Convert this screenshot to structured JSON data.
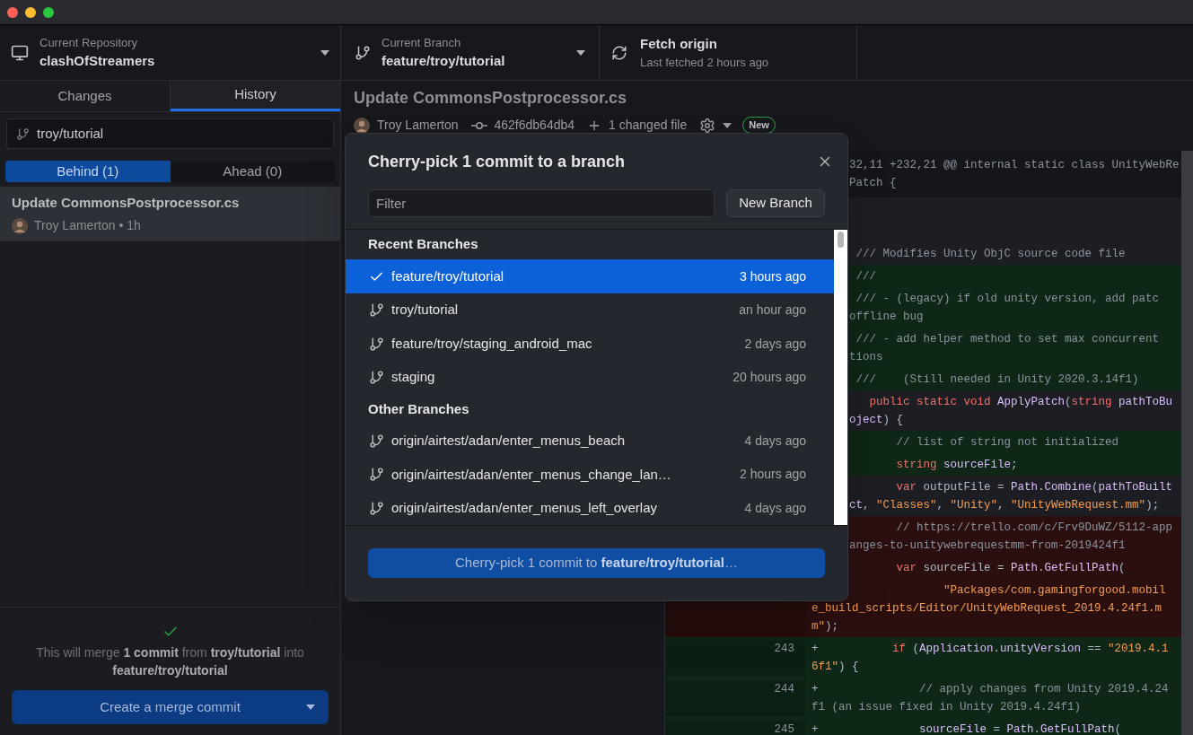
{
  "toolbar": {
    "repository": {
      "label": "Current Repository",
      "value": "clashOfStreamers"
    },
    "branch": {
      "label": "Current Branch",
      "value": "feature/troy/tutorial"
    },
    "fetch": {
      "label": "Fetch origin",
      "detail": "Last fetched 2 hours ago"
    }
  },
  "sidebar": {
    "tabs": [
      {
        "label": "Changes",
        "selected": false
      },
      {
        "label": "History",
        "selected": true
      }
    ],
    "branch_filter": {
      "value": "troy/tutorial"
    },
    "compare_tabs": [
      {
        "label": "Behind (1)",
        "selected": true
      },
      {
        "label": "Ahead (0)",
        "selected": false
      }
    ],
    "commits": [
      {
        "title": "Update CommonsPostprocessor.cs",
        "byline": "Troy Lamerton • 1h",
        "selected": true
      }
    ],
    "merge": {
      "message": "This will merge **1 commit** from **troy/tutorial** into **feature/troy/tutorial**",
      "button": "Create a merge commit"
    }
  },
  "commit": {
    "title": "Update CommonsPostprocessor.cs",
    "author": "Troy Lamerton",
    "sha": "462f6db64db4",
    "changed": "1 changed file",
    "badge": "New"
  },
  "diff": {
    "rows": [
      {
        "kind": "hunk",
        "lines": [
          {
            "code": [
              {
                "text": "32,11 +232,21 @@ internal static class UnityWebRe",
                "kind": "plain"
              }
            ]
          },
          {
            "code": [
              {
                "text": "Patch {",
                "kind": "plain"
              }
            ]
          }
        ]
      },
      {
        "kind": "context"
      },
      {
        "kind": "context"
      },
      {
        "kind": "context",
        "lines": [
          {
            "code": [
              {
                "text": " /// Modifies Unity ObjC source code file",
                "kind": "comment"
              }
            ]
          }
        ]
      },
      {
        "kind": "added",
        "lines": [
          {
            "code": [
              {
                "text": " ///",
                "kind": "comment"
              }
            ]
          }
        ]
      },
      {
        "kind": "added",
        "lines": [
          {
            "code": [
              {
                "text": " /// - (legacy) if old unity version, add patc",
                "kind": "comment"
              }
            ]
          },
          {
            "code": [
              {
                "text": "offline bug",
                "kind": "comment"
              }
            ]
          }
        ]
      },
      {
        "kind": "added",
        "lines": [
          {
            "code": [
              {
                "text": " /// - add helper method to set max concurrent",
                "kind": "comment"
              }
            ]
          },
          {
            "code": [
              {
                "text": "tions",
                "kind": "comment"
              }
            ]
          }
        ]
      },
      {
        "kind": "added",
        "lines": [
          {
            "code": [
              {
                "text": " ///    (Still needed in Unity 2020.3.14f1)",
                "kind": "comment"
              }
            ]
          }
        ]
      },
      {
        "kind": "context",
        "lines": [
          {
            "code": [
              {
                "text": "   public static void ",
                "kind": "keyword"
              },
              {
                "text": "ApplyPatch",
                "kind": "name"
              },
              {
                "text": "(",
                "kind": "plain"
              },
              {
                "text": "string ",
                "kind": "keyword"
              },
              {
                "text": "pathToBu",
                "kind": "name"
              }
            ]
          },
          {
            "code": [
              {
                "text": "oject",
                "kind": "name"
              },
              {
                "text": ") {",
                "kind": "plain"
              }
            ]
          }
        ]
      },
      {
        "kind": "added",
        "lines": [
          {
            "code": [
              {
                "text": "       // list of string not initialized",
                "kind": "comment"
              }
            ]
          }
        ]
      },
      {
        "kind": "added",
        "lines": [
          {
            "code": [
              {
                "text": "       string ",
                "kind": "keyword"
              },
              {
                "text": "sourceFile",
                "kind": "name"
              },
              {
                "text": ";",
                "kind": "plain"
              }
            ]
          }
        ]
      },
      {
        "kind": "context",
        "lines": [
          {
            "code": [
              {
                "text": "       var ",
                "kind": "keyword"
              },
              {
                "text": "outputFile = ",
                "kind": "plain"
              },
              {
                "text": "Path",
                "kind": "name"
              },
              {
                "text": ".",
                "kind": "plain"
              },
              {
                "text": "Combine",
                "kind": "name"
              },
              {
                "text": "(",
                "kind": "plain"
              },
              {
                "text": "pathToBuilt",
                "kind": "name"
              }
            ]
          },
          {
            "code": [
              {
                "text": "ct",
                "kind": "name"
              },
              {
                "text": ", ",
                "kind": "plain"
              },
              {
                "text": "\"Classes\"",
                "kind": "string"
              },
              {
                "text": ", ",
                "kind": "plain"
              },
              {
                "text": "\"Unity\"",
                "kind": "string"
              },
              {
                "text": ", ",
                "kind": "plain"
              },
              {
                "text": "\"UnityWebRequest.mm\"",
                "kind": "string"
              },
              {
                "text": ");",
                "kind": "plain"
              }
            ]
          }
        ]
      },
      {
        "kind": "removed",
        "lines": [
          {
            "code": [
              {
                "text": "       // https://trello.com/c/Frv9DuWZ/5112-app",
                "kind": "comment"
              }
            ]
          },
          {
            "code": [
              {
                "text": "anges-to-unitywebrequestmm-from-2019424f1",
                "kind": "comment"
              }
            ]
          }
        ]
      },
      {
        "kind": "removed",
        "lines": [
          {
            "code": [
              {
                "text": "       var ",
                "kind": "keyword"
              },
              {
                "text": "sourceFile = ",
                "kind": "plain"
              },
              {
                "text": "Path",
                "kind": "name"
              },
              {
                "text": ".",
                "kind": "plain"
              },
              {
                "text": "GetFullPath",
                "kind": "name"
              },
              {
                "text": "(",
                "kind": "plain"
              }
            ]
          }
        ]
      },
      {
        "kind": "removed",
        "lines": [
          {
            "code": [
              {
                "text": "              \"Packages/com.gamingforgood.mobil",
                "kind": "string"
              }
            ]
          },
          {
            "code": [
              {
                "text": "e_build_scripts/Editor/UnityWebRequest_2019.4.24f1.m",
                "kind": "string"
              }
            ]
          },
          {
            "code": [
              {
                "text": "m\"",
                "kind": "string"
              },
              {
                "text": ");",
                "kind": "plain"
              }
            ]
          }
        ]
      },
      {
        "kind": "added",
        "new_number": "243",
        "lines": [
          {
            "code": [
              {
                "text": "+           ",
                "kind": "plain"
              },
              {
                "text": "if ",
                "kind": "keyword"
              },
              {
                "text": "(",
                "kind": "plain"
              },
              {
                "text": "Application",
                "kind": "name"
              },
              {
                "text": ".",
                "kind": "plain"
              },
              {
                "text": "unityVersion",
                "kind": "name"
              },
              {
                "text": " == ",
                "kind": "plain"
              },
              {
                "text": "\"2019.4.1",
                "kind": "string"
              }
            ]
          },
          {
            "code": [
              {
                "text": "6f1\"",
                "kind": "string"
              },
              {
                "text": ") {",
                "kind": "plain"
              }
            ]
          }
        ]
      },
      {
        "kind": "added",
        "new_number": "244",
        "lines": [
          {
            "code": [
              {
                "text": "+               ",
                "kind": "plain"
              },
              {
                "text": "// apply changes from Unity 2019.4.24",
                "kind": "comment"
              }
            ]
          },
          {
            "code": [
              {
                "text": "f1 (an issue fixed in Unity 2019.4.24f1)",
                "kind": "comment"
              }
            ]
          }
        ]
      },
      {
        "kind": "added",
        "new_number": "245",
        "lines": [
          {
            "code": [
              {
                "text": "+               ",
                "kind": "plain"
              },
              {
                "text": "sourceFile",
                "kind": "name"
              },
              {
                "text": " = ",
                "kind": "plain"
              },
              {
                "text": "Path",
                "kind": "name"
              },
              {
                "text": ".",
                "kind": "plain"
              },
              {
                "text": "GetFullPath",
                "kind": "name"
              },
              {
                "text": "(",
                "kind": "plain"
              }
            ]
          }
        ]
      }
    ]
  },
  "dialog": {
    "title": "Cherry-pick 1 commit to a branch",
    "filter": {
      "placeholder": "Filter"
    },
    "new_branch": "New Branch",
    "groups": [
      {
        "header": "Recent Branches",
        "branches": [
          {
            "name": "feature/troy/tutorial",
            "time": "3 hours ago",
            "selected": true
          },
          {
            "name": "troy/tutorial",
            "time": "an hour ago",
            "selected": false
          },
          {
            "name": "feature/troy/staging_android_mac",
            "time": "2 days ago",
            "selected": false
          },
          {
            "name": "staging",
            "time": "20 hours ago",
            "selected": false
          }
        ]
      },
      {
        "header": "Other Branches",
        "branches": [
          {
            "name": "origin/airtest/adan/enter_menus_beach",
            "time": "4 days ago",
            "selected": false
          },
          {
            "name": "origin/airtest/adan/enter_menus_change_lan…",
            "time": "2 hours ago",
            "selected": false
          },
          {
            "name": "origin/airtest/adan/enter_menus_left_overlay",
            "time": "4 days ago",
            "selected": false
          }
        ]
      }
    ],
    "submit": "Cherry-pick 1 commit to **feature/troy/tutorial**…"
  }
}
